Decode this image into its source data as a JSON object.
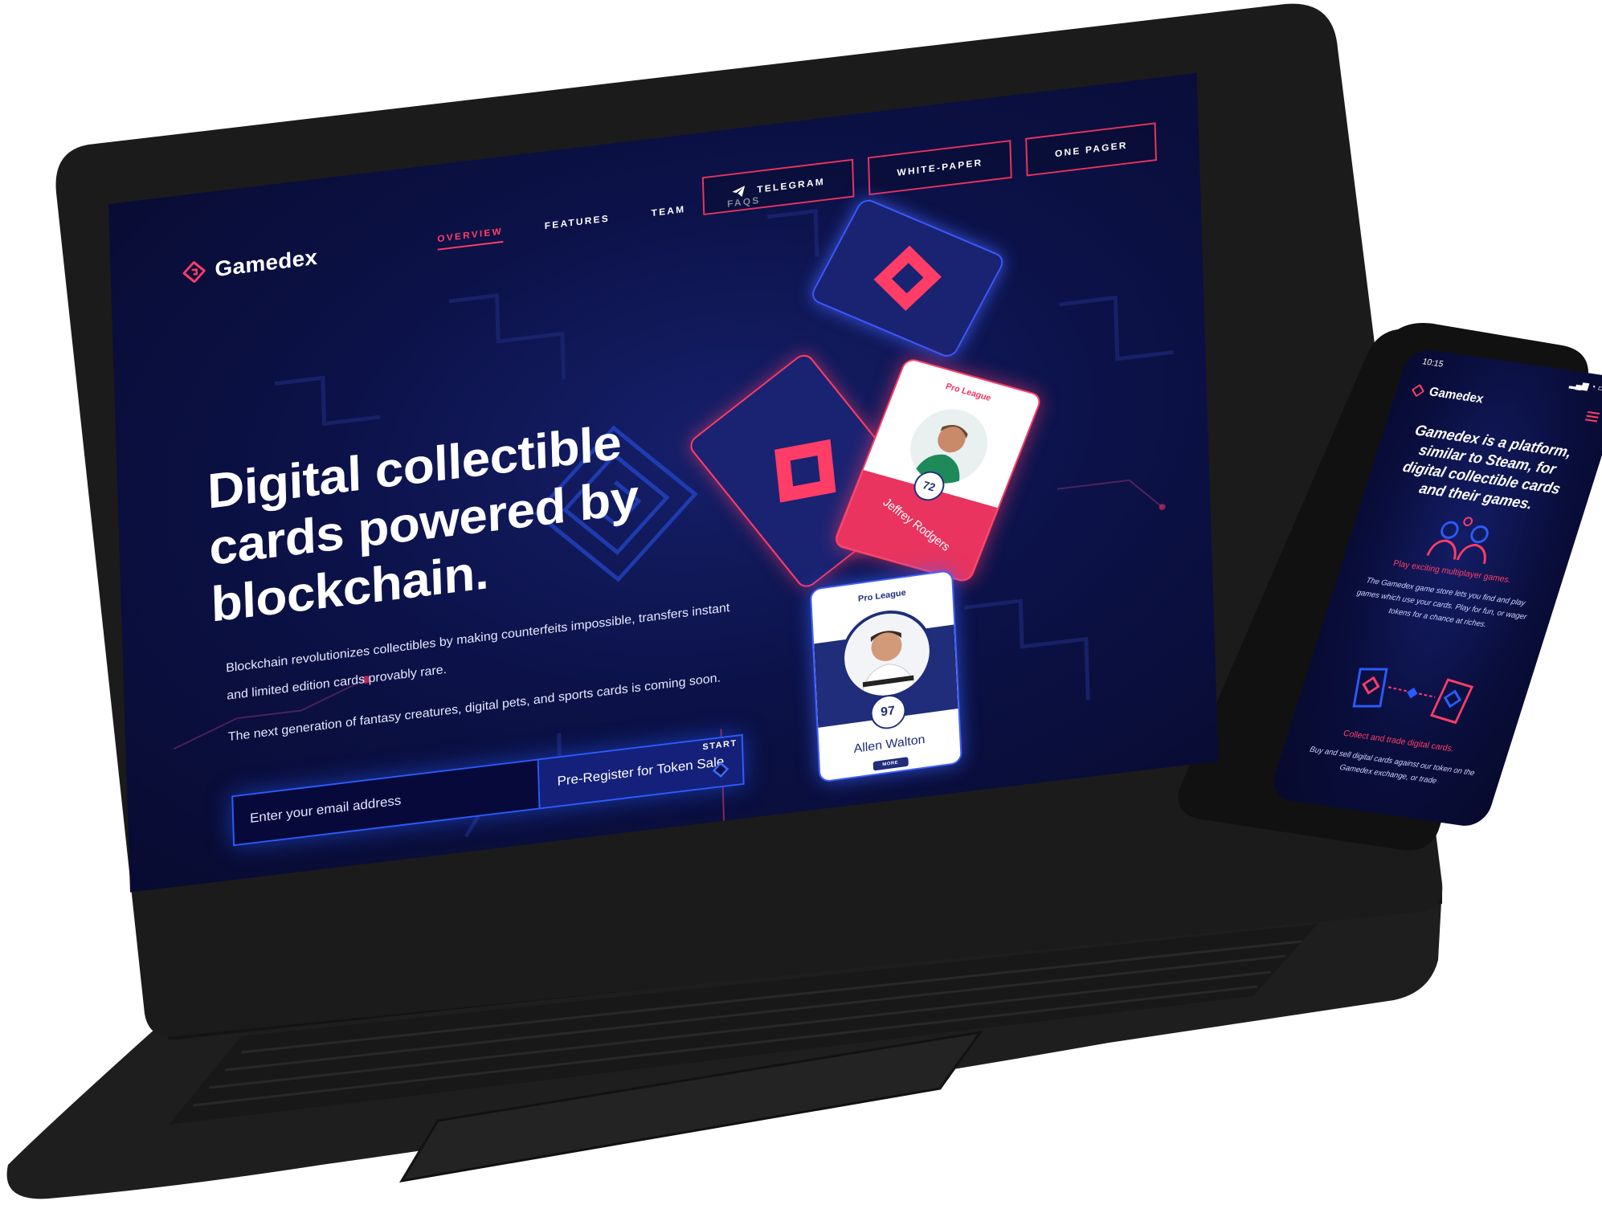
{
  "site": {
    "brand": "Gamedex",
    "nav": [
      "OVERVIEW",
      "FEATURES",
      "TEAM",
      "FAQS"
    ],
    "top_buttons": [
      "TELEGRAM",
      "WHITE-PAPER",
      "ONE PAGER"
    ],
    "headline": "Digital collectible cards powered by blockchain.",
    "paragraph1": "Blockchain revolutionizes collectibles by making counterfeits impossible, transfers instant and limited edition cards provably rare.",
    "paragraph2": "The next generation of fantasy creatures, digital pets, and sports cards is coming soon.",
    "email_placeholder": "Enter your email address",
    "cta_label": "Pre-Register for Token Sale",
    "start_label": "START"
  },
  "cards": [
    {
      "league": "Pro League",
      "rating": "72",
      "name": "Jeffrey Rodgers"
    },
    {
      "league": "Pro League",
      "rating": "97",
      "name": "Allen Walton",
      "more": "MORE"
    }
  ],
  "phone": {
    "time": "10:15",
    "brand": "Gamedex",
    "headline": "Gamedex is a platform, similar to Steam, for digital collectible cards and their games.",
    "section1_title": "Play exciting multiplayer games.",
    "section1_body": "The Gamedex game store lets you find and play games which use your cards. Play for fun, or wager tokens for a chance at riches.",
    "section2_title": "Collect and trade digital cards.",
    "section2_body": "Buy and sell digital cards against our token on the Gamedex exchange, or trade"
  },
  "colors": {
    "accent_red": "#ff3d67",
    "accent_blue": "#2b5cff",
    "screen_bg": "#0c1249",
    "device_body": "#1b1b1b"
  }
}
